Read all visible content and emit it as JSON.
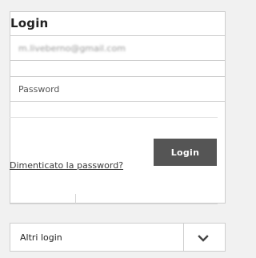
{
  "login": {
    "title": "Login",
    "email_value": "m.liveberno@gmail.com",
    "password_placeholder": "Password",
    "submit_label": "Login",
    "forgot_label": "Dimenticato la password?"
  },
  "other": {
    "select_label": "Altri login",
    "chevron_icon": "chevron-down-icon"
  }
}
